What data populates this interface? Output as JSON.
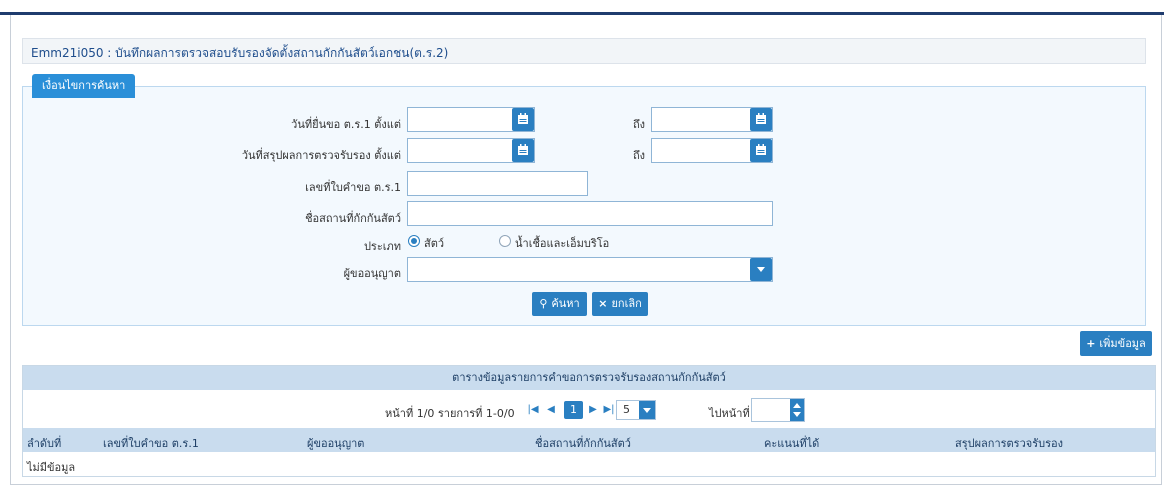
{
  "page": {
    "title": "Emm21i050 : บันทึกผลการตรวจสอบรับรองจัดตั้งสถานกักกันสัตว์เอกชน(ต.ร.2)"
  },
  "search": {
    "tab_label": "เงื่อนไขการค้นหา",
    "request_date_from_label": "วันที่ยื่นขอ ต.ร.1 ตั้งแต่",
    "request_date_to_label": "ถึง",
    "result_date_from_label": "วันที่สรุปผลการตรวจรับรอง ตั้งแต่",
    "result_date_to_label": "ถึง",
    "request_no_label": "เลขที่ใบคำขอ ต.ร.1",
    "station_name_label": "ชื่อสถานที่กักกันสัตว์",
    "type_label": "ประเภท",
    "type_options": [
      "สัตว์",
      "น้ำเชื้อและเอ็มบริโอ"
    ],
    "type_selected": "สัตว์",
    "licensee_label": "ผู้ขออนุญาต",
    "licensee_value": "",
    "request_date_from": "",
    "request_date_to": "",
    "result_date_from": "",
    "result_date_to": "",
    "request_no": "",
    "station_name": "",
    "search_button": "ค้นหา",
    "cancel_button": "ยกเลิก"
  },
  "toolbar": {
    "add_button": "เพิ่มข้อมูล"
  },
  "grid": {
    "title": "ตารางข้อมูลรายการคำขอการตรวจรับรองสถานกักกันสัตว์",
    "pager_info": "หน้าที่ 1/0 รายการที่ 1-0/0",
    "current_page": "1",
    "page_size": "5",
    "goto_label": "ไปหน้าที่",
    "goto_value": "",
    "columns": [
      "ลำดับที่",
      "เลขที่ใบคำขอ ต.ร.1",
      "ผู้ขออนุญาต",
      "ชื่อสถานที่กักกันสัตว์",
      "คะแนนที่ได้",
      "สรุปผลการตรวจรับรอง"
    ],
    "empty_text": "ไม่มีข้อมูล"
  },
  "colors": {
    "primary": "#2a7fc1",
    "tab": "#2a8fd8",
    "grid_header": "#c9dcee",
    "panel_bg": "#f3f9fe",
    "title_text": "#1e4d8c"
  }
}
